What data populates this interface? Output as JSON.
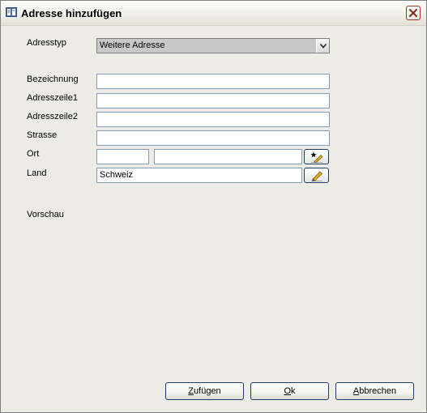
{
  "window": {
    "title": "Adresse hinzufügen"
  },
  "form": {
    "adresstyp": {
      "label": "Adresstyp",
      "value": "Weitere Adresse"
    },
    "bezeichnung": {
      "label": "Bezeichnung",
      "value": ""
    },
    "adresszeile1": {
      "label": "Adresszeile1",
      "value": ""
    },
    "adresszeile2": {
      "label": "Adresszeile2",
      "value": ""
    },
    "strasse": {
      "label": "Strasse",
      "value": ""
    },
    "ort": {
      "label": "Ort",
      "plz_value": "",
      "city_value": ""
    },
    "land": {
      "label": "Land",
      "value": "Schweiz"
    },
    "vorschau": {
      "label": "Vorschau"
    }
  },
  "buttons": {
    "add": {
      "accel": "Z",
      "rest": "ufügen"
    },
    "ok": {
      "accel": "O",
      "rest": "k"
    },
    "cancel": {
      "accel": "A",
      "rest": "bbrechen"
    }
  },
  "icons": {
    "title_icon": "address-book-icon",
    "ort_button_icon": "star-pencil-icon",
    "land_button_icon": "pencil-icon",
    "close_icon": "close-icon",
    "dropdown_icon": "chevron-down-icon"
  },
  "colors": {
    "dialog_background": "#ecebe6",
    "field_border": "#7f9db9",
    "button_border": "#1c3a6e",
    "close_button_border": "#9b3a2a"
  }
}
